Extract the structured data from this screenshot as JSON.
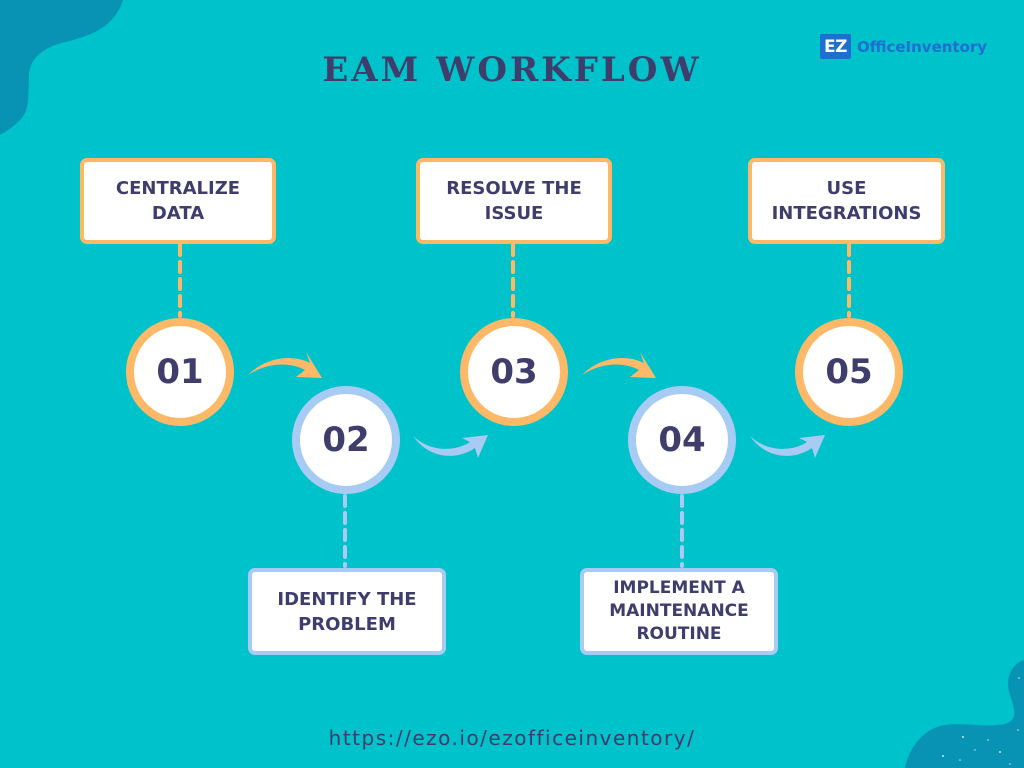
{
  "title": "EAM WORKFLOW",
  "logo": {
    "badge": "EZ",
    "name": "OfficeInventory"
  },
  "colors": {
    "background": "#00C2CB",
    "blob": "#0892B3",
    "orange": "#FDB968",
    "blue": "#A8CBF3",
    "text": "#3F3D6B",
    "brand": "#1E6FD0"
  },
  "steps": [
    {
      "number": "01",
      "label": "CENTRALIZE DATA",
      "color": "orange",
      "position": "top"
    },
    {
      "number": "02",
      "label": "IDENTIFY THE PROBLEM",
      "color": "blue",
      "position": "bottom"
    },
    {
      "number": "03",
      "label": "RESOLVE THE ISSUE",
      "color": "orange",
      "position": "top"
    },
    {
      "number": "04",
      "label": "IMPLEMENT A MAINTENANCE ROUTINE",
      "color": "blue",
      "position": "bottom"
    },
    {
      "number": "05",
      "label": "USE INTEGRATIONS",
      "color": "orange",
      "position": "top"
    }
  ],
  "footer": {
    "url": "https://ezo.io/ezofficeinventory/"
  }
}
